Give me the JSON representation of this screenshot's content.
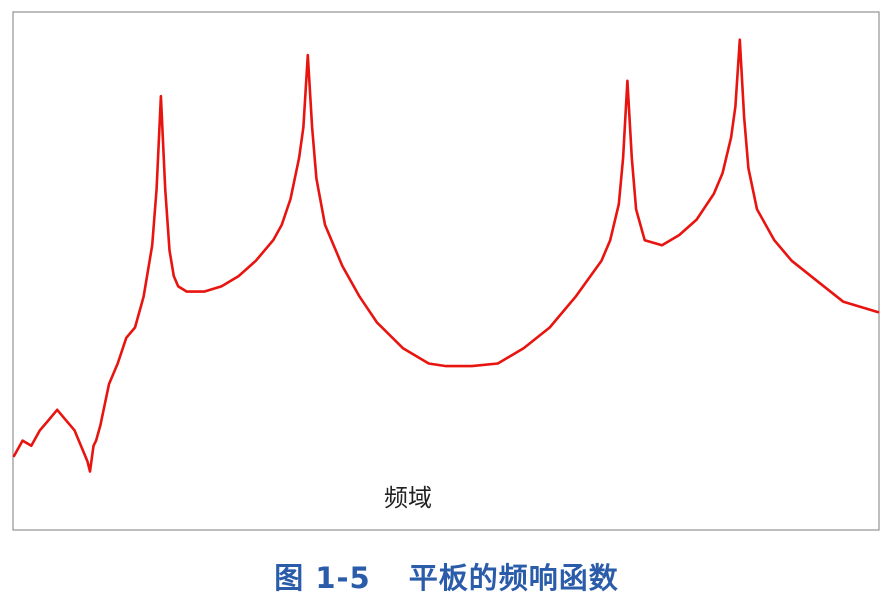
{
  "chart_data": {
    "type": "line",
    "title": "",
    "xlabel": "频域",
    "ylabel": "",
    "series": [
      {
        "x": [
          0.0,
          0.01,
          0.02,
          0.03,
          0.04,
          0.05,
          0.06,
          0.07,
          0.075,
          0.08,
          0.085,
          0.088,
          0.092,
          0.095,
          0.1,
          0.105,
          0.11,
          0.12,
          0.13,
          0.14,
          0.15,
          0.155,
          0.16,
          0.165,
          0.17,
          0.175,
          0.18,
          0.185,
          0.19,
          0.2,
          0.22,
          0.24,
          0.26,
          0.28,
          0.3,
          0.31,
          0.32,
          0.33,
          0.335,
          0.34,
          0.345,
          0.35,
          0.36,
          0.38,
          0.4,
          0.42,
          0.45,
          0.48,
          0.5,
          0.53,
          0.56,
          0.59,
          0.62,
          0.65,
          0.68,
          0.69,
          0.7,
          0.705,
          0.71,
          0.715,
          0.72,
          0.73,
          0.75,
          0.77,
          0.79,
          0.81,
          0.82,
          0.83,
          0.835,
          0.84,
          0.845,
          0.85,
          0.86,
          0.88,
          0.9,
          0.93,
          0.96,
          1.0
        ],
        "y": [
          0.14,
          0.17,
          0.16,
          0.19,
          0.21,
          0.23,
          0.21,
          0.19,
          0.17,
          0.15,
          0.13,
          0.11,
          0.16,
          0.17,
          0.2,
          0.24,
          0.28,
          0.32,
          0.37,
          0.39,
          0.45,
          0.5,
          0.55,
          0.66,
          0.84,
          0.66,
          0.54,
          0.49,
          0.47,
          0.46,
          0.46,
          0.47,
          0.49,
          0.52,
          0.56,
          0.59,
          0.64,
          0.72,
          0.78,
          0.92,
          0.78,
          0.68,
          0.59,
          0.51,
          0.45,
          0.4,
          0.35,
          0.32,
          0.315,
          0.315,
          0.32,
          0.35,
          0.39,
          0.45,
          0.52,
          0.56,
          0.63,
          0.72,
          0.87,
          0.72,
          0.62,
          0.56,
          0.55,
          0.57,
          0.6,
          0.65,
          0.69,
          0.76,
          0.82,
          0.95,
          0.8,
          0.7,
          0.62,
          0.56,
          0.52,
          0.48,
          0.44,
          0.42
        ]
      }
    ],
    "xlim": [
      0,
      1
    ],
    "ylim": [
      0,
      1
    ],
    "grid": false,
    "line_color": "#e8140f"
  },
  "caption": {
    "fig_no": "图 1-5",
    "text": "平板的频响函数"
  },
  "colors": {
    "frame": "#9a9a9a",
    "caption": "#2a5caa"
  }
}
